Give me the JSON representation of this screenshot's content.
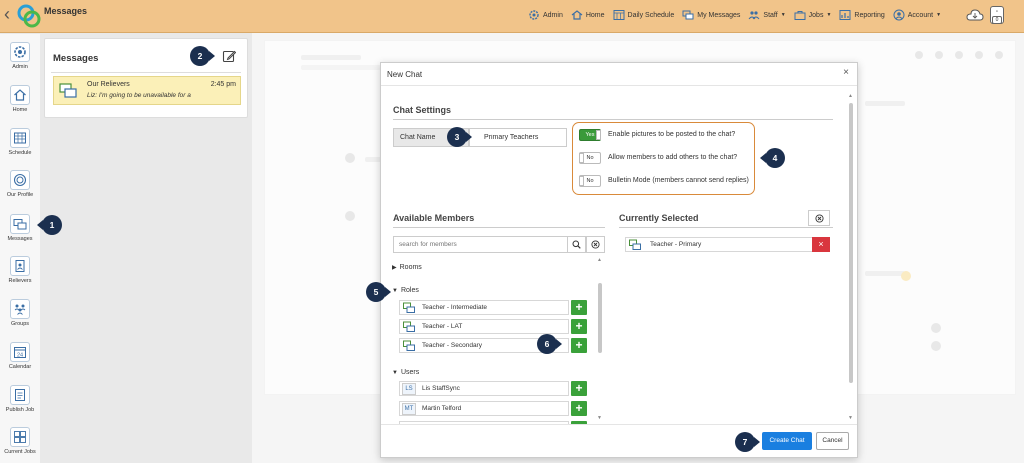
{
  "app": {
    "title": "Messages"
  },
  "topnav": [
    {
      "label": "Admin",
      "icon": "gear-icon",
      "caret": false
    },
    {
      "label": "Home",
      "icon": "home-icon",
      "caret": false
    },
    {
      "label": "Daily Schedule",
      "icon": "schedule-icon",
      "caret": false
    },
    {
      "label": "My Messages",
      "icon": "messages-icon",
      "caret": false
    },
    {
      "label": "Staff",
      "icon": "staff-icon",
      "caret": true
    },
    {
      "label": "Jobs",
      "icon": "jobs-icon",
      "caret": true
    },
    {
      "label": "Reporting",
      "icon": "reporting-icon",
      "caret": false
    },
    {
      "label": "Account",
      "icon": "account-icon",
      "caret": true
    }
  ],
  "notifications": {
    "count": "0"
  },
  "sidebar": {
    "items": [
      {
        "label": "Admin",
        "icon": "gear-icon"
      },
      {
        "label": "Home",
        "icon": "home-icon"
      },
      {
        "label": "Schedule",
        "icon": "schedule-icon"
      },
      {
        "label": "Our Profile",
        "icon": "profile-icon"
      },
      {
        "label": "Messages",
        "icon": "messages-icon"
      },
      {
        "label": "Relievers",
        "icon": "relievers-icon"
      },
      {
        "label": "Groups",
        "icon": "groups-icon"
      },
      {
        "label": "Calendar",
        "icon": "calendar-icon",
        "day": "24"
      },
      {
        "label": "Publish Job",
        "icon": "publish-job-icon"
      },
      {
        "label": "Current Jobs",
        "icon": "current-jobs-icon"
      }
    ]
  },
  "messages_panel": {
    "title": "Messages",
    "threads": [
      {
        "name": "Our Relievers",
        "time": "2:45 pm",
        "preview": "Liz: I'm going to be unavailable for a"
      }
    ]
  },
  "modal": {
    "title": "New Chat",
    "close": "×",
    "chat_settings": {
      "title": "Chat Settings",
      "chat_name_label": "Chat Name",
      "chat_name_value": "Primary Teachers",
      "toggles": [
        {
          "state": "Yes",
          "on": true,
          "label": "Enable pictures to be posted to the chat?"
        },
        {
          "state": "No",
          "on": false,
          "label": "Allow members to add others to the chat?"
        },
        {
          "state": "No",
          "on": false,
          "label": "Bulletin Mode (members cannot send replies)"
        }
      ]
    },
    "available": {
      "title": "Available Members",
      "search_placeholder": "search for members",
      "groups": {
        "rooms": "Rooms",
        "roles": "Roles",
        "users": "Users"
      },
      "roles": [
        {
          "label": "Teacher - Intermediate"
        },
        {
          "label": "Teacher - LAT"
        },
        {
          "label": "Teacher - Secondary"
        }
      ],
      "users": [
        {
          "initials": "LS",
          "label": "Lis StaffSync"
        },
        {
          "initials": "MT",
          "label": "Martin Telford"
        }
      ],
      "add_glyph": "+"
    },
    "selected": {
      "title": "Currently Selected",
      "items": [
        {
          "label": "Teacher - Primary"
        }
      ],
      "remove_glyph": "×"
    },
    "buttons": {
      "create": "Create Chat",
      "cancel": "Cancel"
    }
  },
  "steps": [
    "1",
    "2",
    "3",
    "4",
    "5",
    "6",
    "7"
  ],
  "colors": {
    "topbar": "#f1c48a",
    "accent_green": "#3aa13a",
    "primary_blue": "#1a7fe0",
    "remove_red": "#d9363e",
    "step_marker": "#1b2f4f",
    "highlight_orange": "#d98a3a",
    "thread_highlight": "#fbf0b8"
  }
}
